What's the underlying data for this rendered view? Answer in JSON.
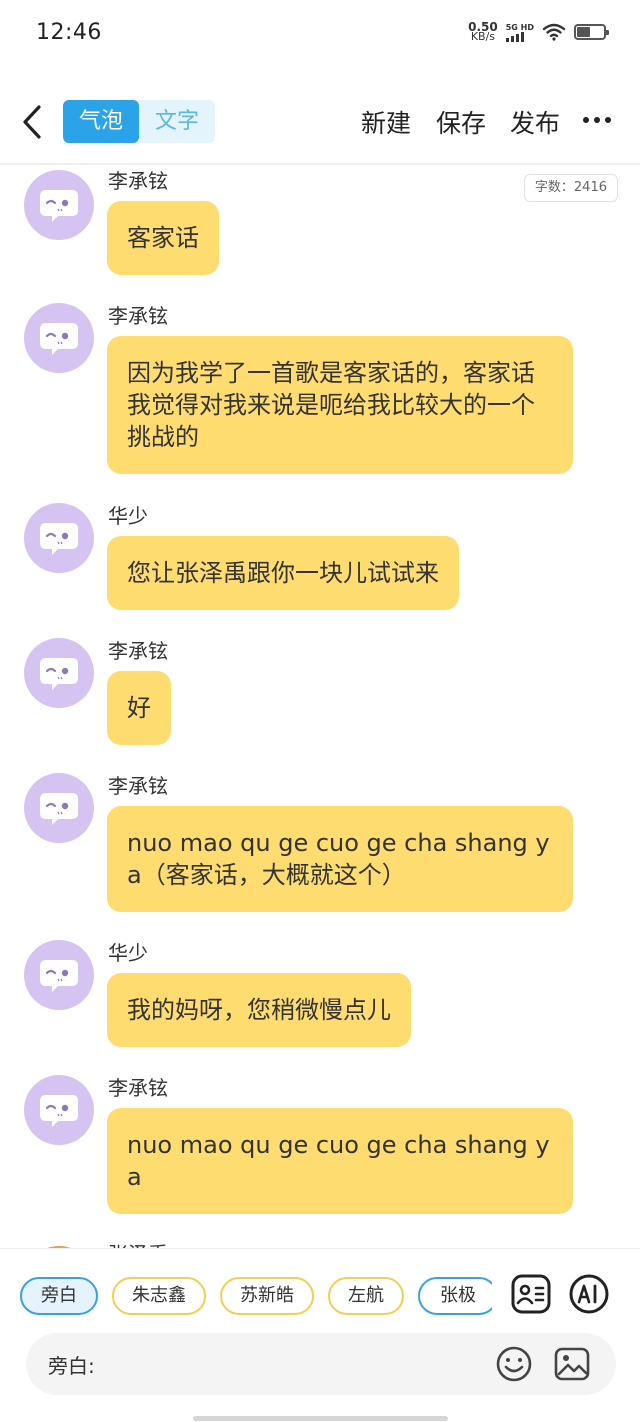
{
  "status_bar": {
    "time": "12:46",
    "net_speed_value": "0.50",
    "net_speed_unit": "KB/s",
    "signal_label": "5G HD",
    "battery_level": 0.5
  },
  "top_nav": {
    "tabs": [
      {
        "label": "气泡",
        "active": true
      },
      {
        "label": "文字",
        "active": false
      }
    ],
    "new_label": "新建",
    "save_label": "保存",
    "publish_label": "发布",
    "more_label": "···"
  },
  "word_count": "字数：2416",
  "messages": [
    {
      "sender": "李承铉",
      "text": "客家话"
    },
    {
      "sender": "李承铉",
      "text": "因为我学了一首歌是客家话的，客家话我觉得对我来说是呃给我比较大的一个挑战的"
    },
    {
      "sender": "华少",
      "text": "您让张泽禹跟你一块儿试试来"
    },
    {
      "sender": "李承铉",
      "text": "好"
    },
    {
      "sender": "李承铉",
      "text": "nuo mao qu ge cuo ge cha shang ya（客家话，大概就这个）"
    },
    {
      "sender": "华少",
      "text": "我的妈呀，您稍微慢点儿"
    },
    {
      "sender": "李承铉",
      "text": "nuo mao qu ge cuo ge cha shang ya"
    },
    {
      "sender": "张泽禹",
      "text": ""
    }
  ],
  "character_chips": [
    "旁白",
    "朱志鑫",
    "苏新皓",
    "左航",
    "张极"
  ],
  "input": {
    "label": "旁白:"
  },
  "colors": {
    "accent_blue": "#2ba3e8",
    "bubble_yellow": "#ffdc6f",
    "avatar_purple": "#d5c4f1",
    "chip_yellow_border": "#f2cf52"
  }
}
